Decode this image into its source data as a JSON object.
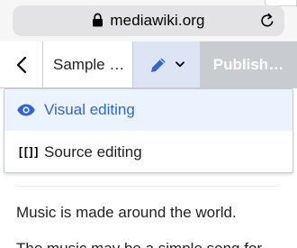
{
  "browser": {
    "url": "mediawiki.org"
  },
  "toolbar": {
    "title": "Sample …",
    "publish_label": "Publish…"
  },
  "edit_menu": {
    "items": [
      {
        "label": "Visual editing",
        "icon": "eye-icon",
        "selected": true
      },
      {
        "label": "Source editing",
        "icon": "wikitext-brackets-icon",
        "selected": false
      }
    ]
  },
  "content": {
    "paragraphs": [
      "Music is made around the world.",
      "The music may be a simple song for"
    ]
  },
  "colors": {
    "accent": "#3366cc",
    "selected_bg": "#eaf3ff",
    "editmode_bg": "#dde5f5",
    "publish_disabled": "#c8ccd1"
  }
}
